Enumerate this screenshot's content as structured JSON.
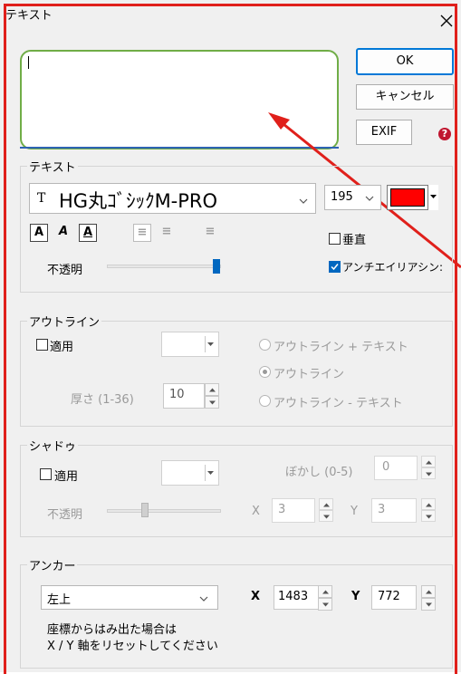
{
  "window": {
    "title": "テキスト",
    "close_label": "×"
  },
  "text_input": {
    "value": ""
  },
  "buttons": {
    "ok": "OK",
    "cancel": "キャンセル",
    "exif": "EXIF",
    "help": "?"
  },
  "text_group": {
    "legend": "テキスト",
    "font_icon": "T",
    "font_name": "HG丸ｺﾞｼｯｸM-PRO",
    "size": "195",
    "color": "#ff0000",
    "style_bold": "A",
    "style_italic": "A",
    "style_underline": "A",
    "align_left": "≡",
    "align_center": "≡",
    "align_right": "≡",
    "vertical_label": "垂直",
    "vertical_checked": false,
    "opacity_label": "不透明",
    "opacity_level": 1.0,
    "antialias_label": "アンチエイリアシン:",
    "antialias_checked": true
  },
  "outline_group": {
    "legend": "アウトライン",
    "apply_label": "適用",
    "apply_checked": false,
    "thickness_label": "厚さ (1-36)",
    "thickness_value": "10",
    "options": [
      "アウトライン + テキスト",
      "アウトライン",
      "アウトライン - テキスト"
    ],
    "selected": "アウトライン"
  },
  "shadow_group": {
    "legend": "シャドゥ",
    "apply_label": "適用",
    "apply_checked": false,
    "blur_label": "ぼかし (0-5)",
    "blur_value": "0",
    "opacity_label": "不透明",
    "opacity_level": 0.3,
    "x_label": "X",
    "x_value": "3",
    "y_label": "Y",
    "y_value": "3"
  },
  "anchor_group": {
    "legend": "アンカー",
    "anchor_value": "左上",
    "x_label": "X",
    "x_value": "1483",
    "y_label": "Y",
    "y_value": "772",
    "note_line1": "座標からはみ出た場合は",
    "note_line2": "X / Y 軸をリセットしてください"
  },
  "colors": {
    "annotation_red": "#e0201b",
    "textbox_green": "#70ad47",
    "accent_blue": "#0067c0"
  }
}
